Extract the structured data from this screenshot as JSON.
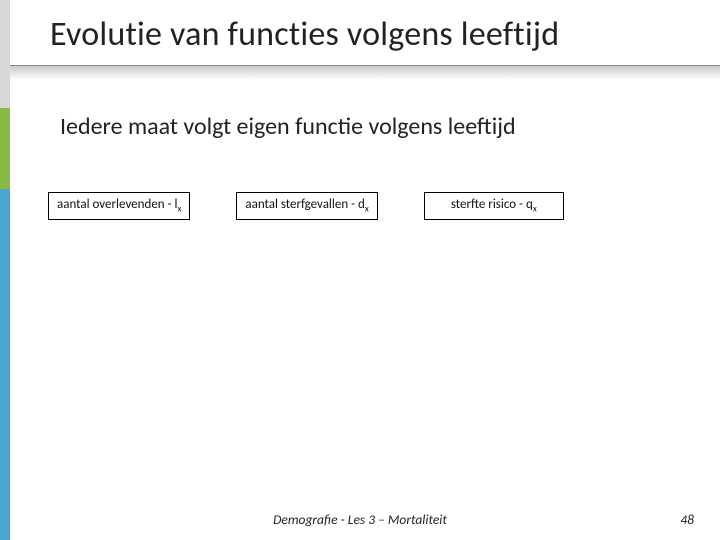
{
  "title": "Evolutie van functies volgens leeftijd",
  "subtitle": "Iedere maat volgt eigen functie volgens leeftijd",
  "boxes": {
    "b1_pre": "aantal overlevenden - l",
    "b1_sub": "x",
    "b2_pre": "aantal sterfgevallen - d",
    "b2_sub": "x",
    "b3_pre": "sterfte risico - q",
    "b3_sub": "x"
  },
  "footer": "Demografie - Les 3 – Mortaliteit",
  "page": "48"
}
